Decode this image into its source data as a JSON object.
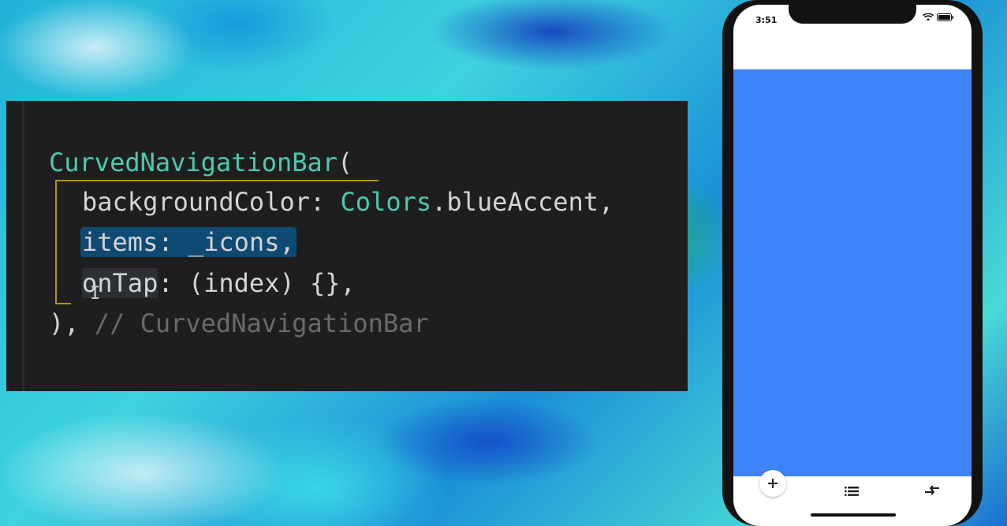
{
  "code": {
    "line1": {
      "name": "CurvedNavigationBar",
      "punct": "("
    },
    "line2": {
      "key": "backgroundColor: ",
      "cls": "Colors",
      "rest": ".blueAccent,"
    },
    "line3": {
      "selected": "items: _icons,"
    },
    "line4": {
      "key": "onTap",
      "rest": ": (index) {},"
    },
    "line5": {
      "close": "),",
      "comment": " // CurvedNavigationBar"
    }
  },
  "phone": {
    "status_time": "3:51",
    "accent_color": "#3e82f7",
    "nav_items": [
      {
        "icon": "add-icon",
        "active": true
      },
      {
        "icon": "list-icon",
        "active": false
      },
      {
        "icon": "compare-arrows-icon",
        "active": false
      }
    ]
  },
  "colors": {
    "editor_bg": "#1e1e1e",
    "class_teal": "#4ec9b0",
    "selection": "#0f4a73",
    "bracket_guide": "#b8921d"
  }
}
